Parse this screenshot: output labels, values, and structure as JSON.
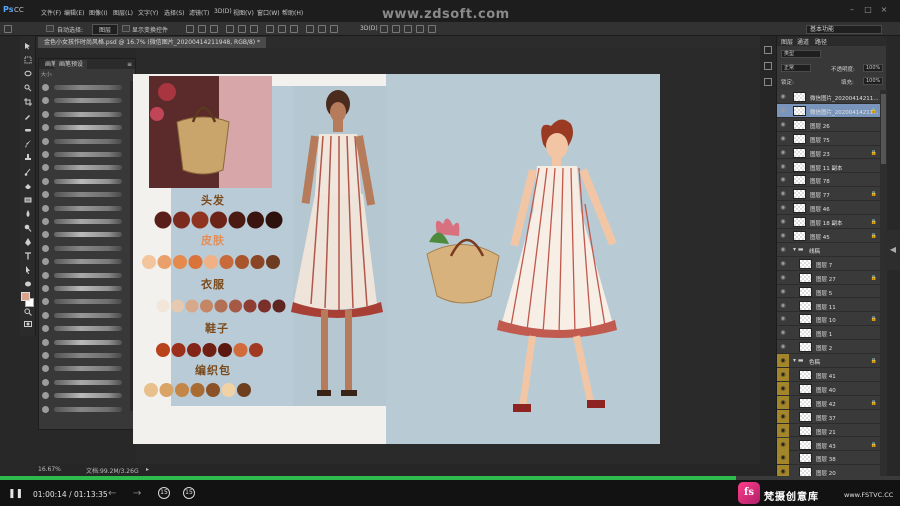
{
  "app": {
    "logo": "Ps",
    "version": "CC",
    "menu": [
      "文件(F)",
      "编辑(E)",
      "图像(I)",
      "图层(L)",
      "文字(Y)",
      "选择(S)",
      "滤镜(T)",
      "3D(D)",
      "视图(V)",
      "窗口(W)",
      "帮助(H)"
    ]
  },
  "watermark": "www.zdsoft.com",
  "options_bar": {
    "auto_select_label": "自动选择:",
    "auto_select_value": "图层",
    "show_transform_label": "显示变换控件",
    "workspace": "基本功能"
  },
  "document_tab": "金色小女孩作时尚风格.psd @ 16.7% (微信图片_20200414211948, RGB/8) *",
  "status": {
    "zoom": "16.67%",
    "doc_size": "文档:99.2M/3.26G"
  },
  "brush_panel": {
    "tabs": [
      "画笔",
      "画笔预设"
    ],
    "size_label": "大小:"
  },
  "layers_panel": {
    "tabs": [
      "图层",
      "通道",
      "路径"
    ],
    "kind_label": "类型",
    "blend_mode": "正常",
    "opacity_label": "不透明度:",
    "opacity_value": "100%",
    "lock_label": "锁定:",
    "fill_label": "填充:",
    "fill_value": "100%",
    "layers": [
      {
        "name": "微信图片_20200414211...",
        "selected": false
      },
      {
        "name": "微信图片_20200414211...",
        "selected": true
      },
      {
        "name": "图层 26",
        "selected": false
      },
      {
        "name": "图层 75",
        "selected": false
      },
      {
        "name": "图层 23",
        "selected": false
      },
      {
        "name": "图层 11 副本",
        "selected": false
      },
      {
        "name": "图层 78",
        "selected": false
      },
      {
        "name": "图层 77",
        "selected": false
      },
      {
        "name": "图层 46",
        "selected": false
      },
      {
        "name": "图层 18 副本",
        "selected": false
      },
      {
        "name": "图层 45",
        "selected": false
      },
      {
        "name": "线稿",
        "selected": false,
        "group": true
      },
      {
        "name": "图层 7",
        "selected": false
      },
      {
        "name": "图层 27",
        "selected": false
      },
      {
        "name": "图层 5",
        "selected": false
      },
      {
        "name": "图层 11",
        "selected": false
      },
      {
        "name": "图层 10",
        "selected": false
      },
      {
        "name": "图层 1",
        "selected": false
      },
      {
        "name": "图层 2",
        "selected": false
      },
      {
        "name": "色稿",
        "selected": false,
        "group": true
      },
      {
        "name": "图层 41",
        "selected": false
      },
      {
        "name": "图层 40",
        "selected": false
      },
      {
        "name": "图层 42",
        "selected": false
      },
      {
        "name": "图层 37",
        "selected": false
      },
      {
        "name": "图层 21",
        "selected": false
      },
      {
        "name": "图层 43",
        "selected": false
      },
      {
        "name": "图层 38",
        "selected": false
      },
      {
        "name": "图层 20",
        "selected": false
      }
    ]
  },
  "canvas": {
    "labels": {
      "hair": "头发",
      "skin": "皮肤",
      "clothes": "衣服",
      "shoes": "鞋子",
      "bag": "编织包"
    },
    "palette": {
      "hair": [
        "#5a1f18",
        "#7a2a1e",
        "#8e3421",
        "#6d2418",
        "#4a1a13",
        "#3b1410",
        "#2e100c"
      ],
      "skin": [
        "#f2c59c",
        "#e9a06a",
        "#e48a4d",
        "#d9733a",
        "#f0b184",
        "#c86a3b",
        "#a9552c",
        "#8b4524",
        "#6e3a20"
      ],
      "clothes": [
        "#f1e6d9",
        "#e6c9b1",
        "#d7a98a",
        "#c58665",
        "#b36f53",
        "#a65945",
        "#8e3d33",
        "#7a2f2a",
        "#5e2521"
      ],
      "shoes": [
        "#b8421c",
        "#9b2f1c",
        "#842617",
        "#6f1f13",
        "#5b1810",
        "#d26b3c",
        "#a03a22"
      ],
      "bag": [
        "#e8c08c",
        "#d9a466",
        "#c48548",
        "#a86b33",
        "#8a5226",
        "#f1d2a6",
        "#6e3f1d"
      ]
    }
  },
  "player": {
    "time_current": "01:00:14",
    "time_sep": "/",
    "time_total": "01:13:35",
    "progress_fraction": 0.818,
    "back15": "15",
    "fwd15": "15",
    "brand_cn": "梵摄创意库",
    "brand_url": "www.FSTVC.CC"
  }
}
